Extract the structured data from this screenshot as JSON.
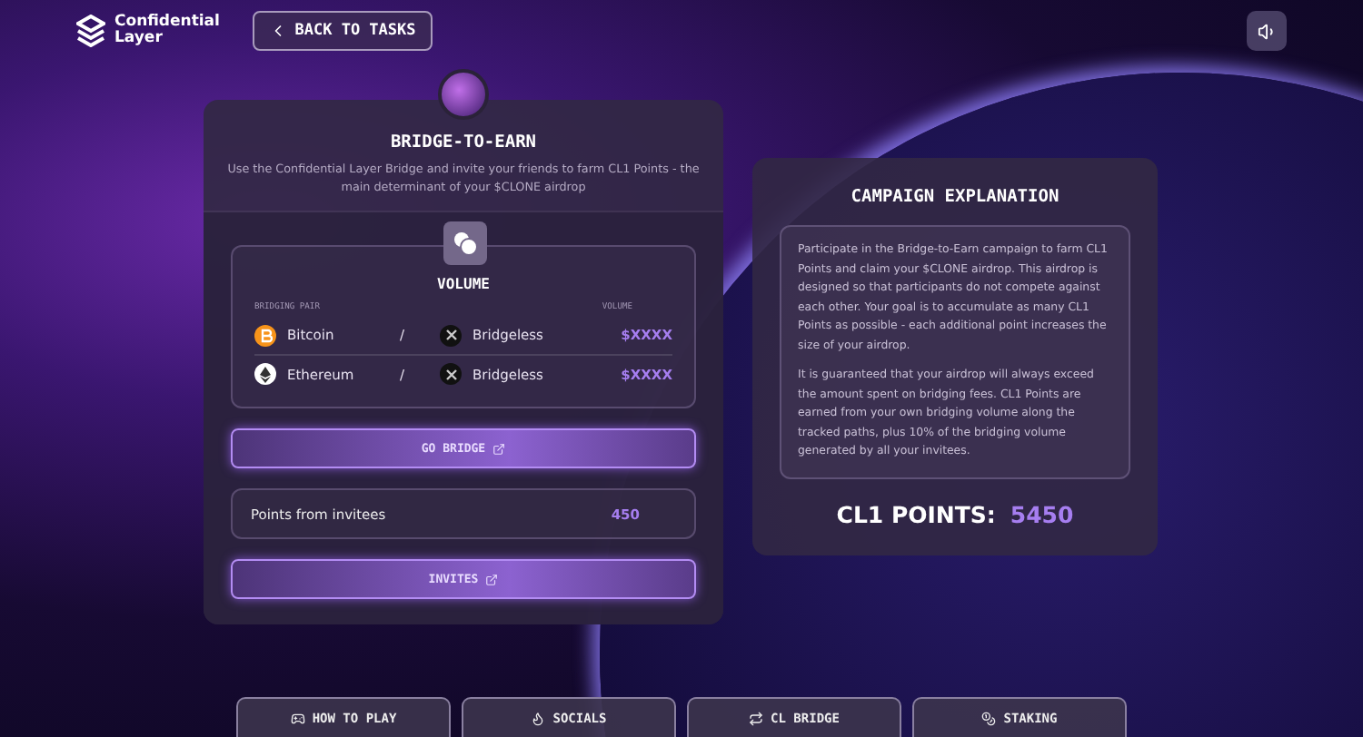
{
  "header": {
    "logo": "Confidential Layer",
    "back_button": "BACK TO TASKS"
  },
  "task": {
    "title": "BRIDGE-TO-EARN",
    "subtitle": "Use the Confidential Layer Bridge and invite your friends to farm CL1 Points - the main determinant of your $CLONE airdrop",
    "volume": {
      "title": "VOLUME",
      "columns": [
        "BRIDGING PAIR",
        "VOLUME"
      ],
      "rows": [
        {
          "kind": "bitcoin",
          "from": "Bitcoin",
          "separator": "/",
          "to": "Bridgeless",
          "volume": "$XXXX"
        },
        {
          "kind": "ethereum",
          "from": "Ethereum",
          "separator": "/",
          "to": "Bridgeless",
          "volume": "$XXXX"
        }
      ]
    },
    "bridge_button": "GO BRIDGE",
    "invitees": {
      "label": "Points from invitees",
      "value": "450"
    },
    "invites_button": "INVITES"
  },
  "explanation": {
    "title": "CAMPAIGN EXPLANATION",
    "paragraphs": [
      "Participate in the Bridge-to-Earn campaign to farm CL1 Points and claim your $CLONE airdrop. This airdrop is designed so that participants do not compete against each other. Your goal is to accumulate as many CL1 Points as possible - each additional point increases the size of your airdrop.",
      "It is guaranteed that your airdrop will always exceed the amount spent on bridging fees. CL1 Points are earned from your own bridging volume along the tracked paths, plus 10% of the bridging volume generated by all your invitees."
    ],
    "points_label": "CL1 POINTS:",
    "points_value": "5450"
  },
  "bottom_tabs": [
    {
      "label": "HOW TO PLAY",
      "kind": "play"
    },
    {
      "label": "SOCIALS",
      "kind": "socials"
    },
    {
      "label": "CL BRIDGE",
      "kind": "bridge"
    },
    {
      "label": "STAKING",
      "kind": "staking"
    }
  ]
}
